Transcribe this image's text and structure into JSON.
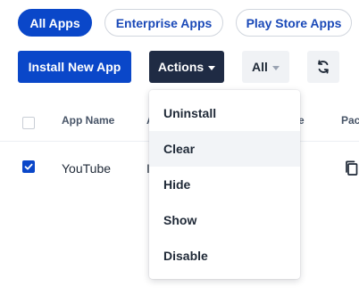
{
  "filters": {
    "all_apps": "All Apps",
    "enterprise_apps": "Enterprise Apps",
    "play_store_apps": "Play Store Apps",
    "active": "All Apps"
  },
  "toolbar": {
    "install_label": "Install New App",
    "actions_label": "Actions",
    "filter_value": "All",
    "refresh_icon": "refresh-icon"
  },
  "table": {
    "columns": [
      "App Name",
      "A",
      "e",
      "Pac"
    ],
    "rows": [
      {
        "checked": true,
        "app_name": "YouTube",
        "col2_fragment": "I",
        "package_icon": "copy-icon"
      }
    ]
  },
  "actions_menu": {
    "items": [
      "Uninstall",
      "Clear",
      "Hide",
      "Show",
      "Disable"
    ],
    "highlighted": "Clear"
  },
  "colors": {
    "primary": "#0a47c9",
    "dark": "#1f2b44",
    "chip_text": "#1a49b8"
  }
}
